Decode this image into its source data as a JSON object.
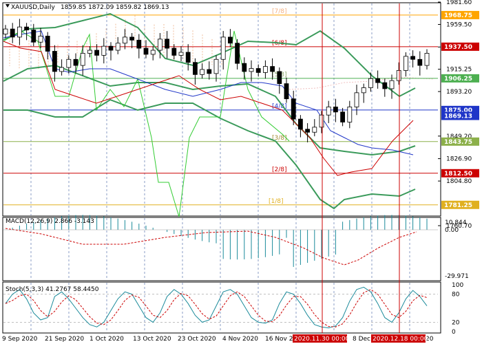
{
  "header": {
    "symbol": "XAUUSD,Daily",
    "ohlc": "1859.85 1872.09 1859.82 1869.13"
  },
  "main_panel": {
    "price_ticks": [
      "1981.60",
      "1959.50",
      "1937.20",
      "1915.25",
      "1893.20",
      "1849.20",
      "1826.90",
      "1804.80",
      "1760.70"
    ],
    "murray_levels": [
      {
        "label": "[7/8]",
        "price": "1968.75",
        "color": "#ffa500",
        "label_color": "#f4b183"
      },
      {
        "label": "[6/8]",
        "price": "1937.50",
        "color": "#cc0000",
        "label_color": "#cc0000"
      },
      {
        "label": "[5/8]",
        "price": "1906.25",
        "color": "#4caf50",
        "label_color": "#8aa66a"
      },
      {
        "label": "[4/8]",
        "price": "1875.00",
        "color": "#1f35c8",
        "label_color": "#1f35c8"
      },
      {
        "label": "[3/8]",
        "price": "1843.75",
        "color": "#8cb04a",
        "label_color": "#a08a30"
      },
      {
        "label": "[2/8]",
        "price": "1812.50",
        "color": "#cc0000",
        "label_color": "#cc0000"
      },
      {
        "label": "[1/8]",
        "price": "1781.25",
        "color": "#e0b020",
        "label_color": "#e0b020"
      }
    ],
    "current_price": "1869.13",
    "current_price_color": "#1f35c8"
  },
  "macd_panel": {
    "title": "MACD(12,26,9) 2.866 -3.143",
    "ticks": [
      "10.844",
      "0.00",
      "-29.971"
    ]
  },
  "stoch_panel": {
    "title": "Stoch(5,3,3) 41.2767 58.4450",
    "ticks": [
      "100",
      "80",
      "20",
      "0"
    ]
  },
  "x_axis": {
    "dates": [
      "9 Sep 2020",
      "21 Sep 2020",
      "1 Oct 2020",
      "13 Oct 2020",
      "23 Oct 2020",
      "4 Nov 2020",
      "16 Nov 20",
      "8 Dec",
      "20"
    ],
    "markers": [
      "2020.11.30 00:00",
      "2020.12.18 00:00"
    ]
  },
  "colors": {
    "up_candle": "#ffffff",
    "down_candle": "#000000",
    "bollinger": "#3a9a5a",
    "vertical_marker": "#cc0000",
    "macd_hist": "#1a8a9a",
    "macd_signal": "#cc0000",
    "stoch_main": "#1a8a9a",
    "stoch_signal": "#cc0000"
  }
}
